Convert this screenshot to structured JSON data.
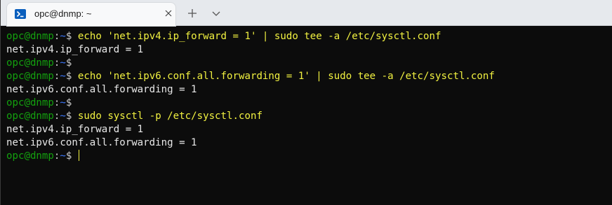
{
  "tab": {
    "title": "opc@dnmp: ~",
    "icon": "terminal-icon"
  },
  "colors": {
    "user_host": "#13a10e",
    "path": "#3b78ff",
    "command": "#f1f140",
    "output": "#e8e8e8"
  },
  "terminal": {
    "lines": [
      {
        "type": "prompt",
        "user": "opc@dnmp",
        "path": "~",
        "sigil": "$",
        "command": "echo 'net.ipv4.ip_forward = 1' | sudo tee -a /etc/sysctl.conf"
      },
      {
        "type": "output",
        "text": "net.ipv4.ip_forward = 1"
      },
      {
        "type": "prompt",
        "user": "opc@dnmp",
        "path": "~",
        "sigil": "$",
        "command": ""
      },
      {
        "type": "prompt",
        "user": "opc@dnmp",
        "path": "~",
        "sigil": "$",
        "command": "echo 'net.ipv6.conf.all.forwarding = 1' | sudo tee -a /etc/sysctl.conf"
      },
      {
        "type": "output",
        "text": "net.ipv6.conf.all.forwarding = 1"
      },
      {
        "type": "prompt",
        "user": "opc@dnmp",
        "path": "~",
        "sigil": "$",
        "command": ""
      },
      {
        "type": "prompt",
        "user": "opc@dnmp",
        "path": "~",
        "sigil": "$",
        "command": "sudo sysctl -p /etc/sysctl.conf"
      },
      {
        "type": "output",
        "text": "net.ipv4.ip_forward = 1"
      },
      {
        "type": "output",
        "text": "net.ipv6.conf.all.forwarding = 1"
      },
      {
        "type": "prompt",
        "user": "opc@dnmp",
        "path": "~",
        "sigil": "$",
        "command": "",
        "cursor": true
      }
    ]
  }
}
